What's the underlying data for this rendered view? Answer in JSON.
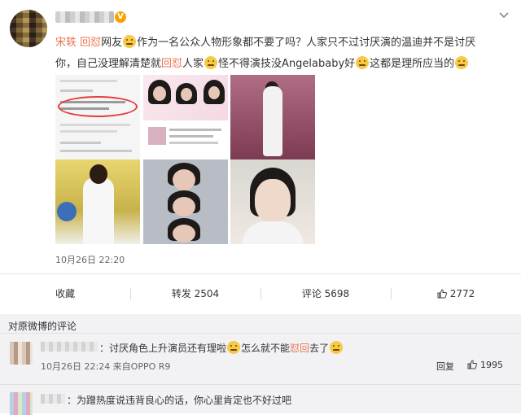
{
  "post": {
    "verified_badge": "V",
    "text_parts": [
      {
        "t": "宋轶 回怼",
        "red": true
      },
      {
        "t": "网友",
        "red": false
      },
      {
        "emoji": "thinking-emoji"
      },
      {
        "t": "作为一名公众人物形象都不要了吗？人家只不过讨厌演的温迪并不是讨厌你，自己没理解清楚就",
        "red": false
      },
      {
        "t": "回怼",
        "red": true
      },
      {
        "t": "人家",
        "red": false
      },
      {
        "emoji": "smirk-emoji"
      },
      {
        "t": "怪不得演技没Angelababy好",
        "red": false
      },
      {
        "emoji": "shock-emoji"
      },
      {
        "t": "这都是理所应当的",
        "red": false
      },
      {
        "emoji": "grin-emoji"
      }
    ],
    "time": "10月26日 22:20"
  },
  "actions": {
    "favorite_label": "收藏",
    "repost_label": "转发 2504",
    "comment_label": "评论 5698",
    "like_count": "2772"
  },
  "comments": {
    "section_title": "对原微博的评论",
    "items": [
      {
        "text_before": "：讨厌角色上升演员还有理啦",
        "text_mid": "怎么就不能",
        "text_red": "怼回",
        "text_after": "去了",
        "meta": "10月26日 22:24 来自OPPO R9",
        "reply_label": "回复",
        "like_count": "1995"
      },
      {
        "text_before": "：为蹭热度说违背良心的话，你心里肯定也不好过吧"
      }
    ]
  },
  "colors": {
    "highlight": "#eb7350",
    "comment_bg": "#f2f2f5",
    "verified": "#f7a200"
  }
}
